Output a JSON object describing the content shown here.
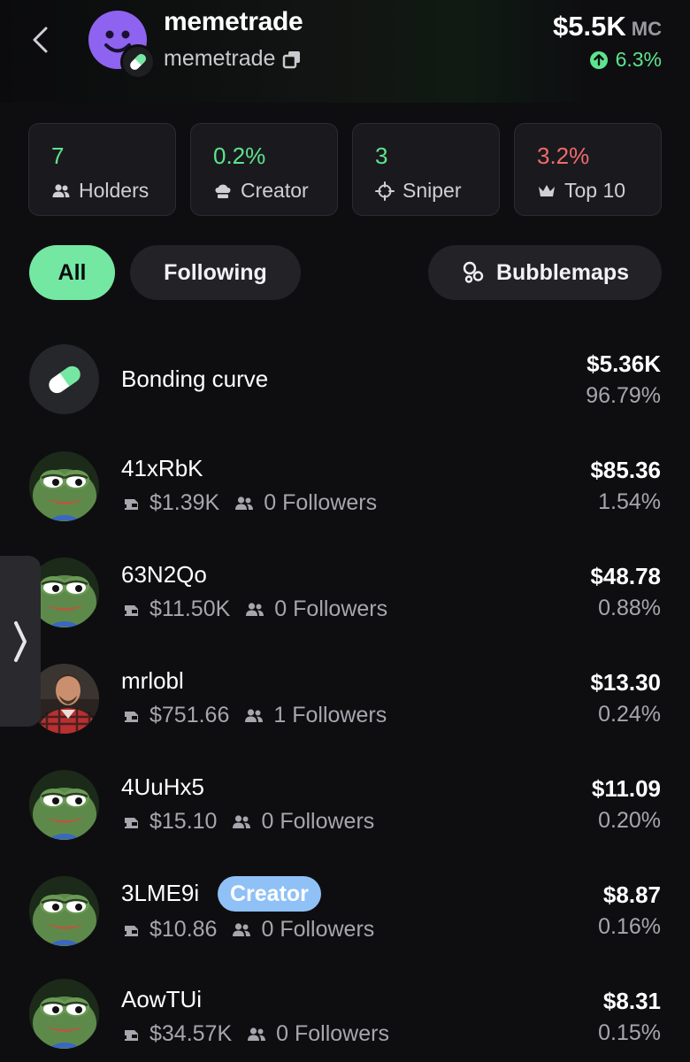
{
  "header": {
    "token_name": "memetrade",
    "token_symbol": "memetrade",
    "market_cap": "$5.5K",
    "market_cap_label": "MC",
    "change": "6.3%"
  },
  "stats": [
    {
      "value": "7",
      "label": "Holders",
      "icon": "users-icon",
      "color": "#5ee38e"
    },
    {
      "value": "0.2%",
      "label": "Creator",
      "icon": "chef-hat-icon",
      "color": "#5ee38e"
    },
    {
      "value": "3",
      "label": "Sniper",
      "icon": "crosshair-icon",
      "color": "#5ee38e"
    },
    {
      "value": "3.2%",
      "label": "Top 10",
      "icon": "crown-icon",
      "color": "#ef6b6b"
    }
  ],
  "filters": {
    "all": "All",
    "following": "Following",
    "bubblemaps": "Bubblemaps"
  },
  "bonding": {
    "name": "Bonding curve",
    "amount": "$5.36K",
    "pct": "96.79%"
  },
  "holders": [
    {
      "name": "41xRbK",
      "balance": "$1.39K",
      "followers": "0 Followers",
      "amount": "$85.36",
      "pct": "1.54%"
    },
    {
      "name": "63N2Qo",
      "balance": "$11.50K",
      "followers": "0 Followers",
      "amount": "$48.78",
      "pct": "0.88%"
    },
    {
      "name": "mrlobl",
      "balance": "$751.66",
      "followers": "1 Followers",
      "amount": "$13.30",
      "pct": "0.24%"
    },
    {
      "name": "4UuHx5",
      "balance": "$15.10",
      "followers": "0 Followers",
      "amount": "$11.09",
      "pct": "0.20%"
    },
    {
      "name": "3LME9i",
      "badge": "Creator",
      "balance": "$10.86",
      "followers": "0 Followers",
      "amount": "$8.87",
      "pct": "0.16%"
    },
    {
      "name": "AowTUi",
      "balance": "$34.57K",
      "followers": "0 Followers",
      "amount": "$8.31",
      "pct": "0.15%"
    }
  ],
  "colors": {
    "accent_green": "#74e8a2",
    "positive": "#5ee38e",
    "negative": "#ef6b6b",
    "creator_badge": "#8fc1f7",
    "background": "#0e0e11"
  }
}
